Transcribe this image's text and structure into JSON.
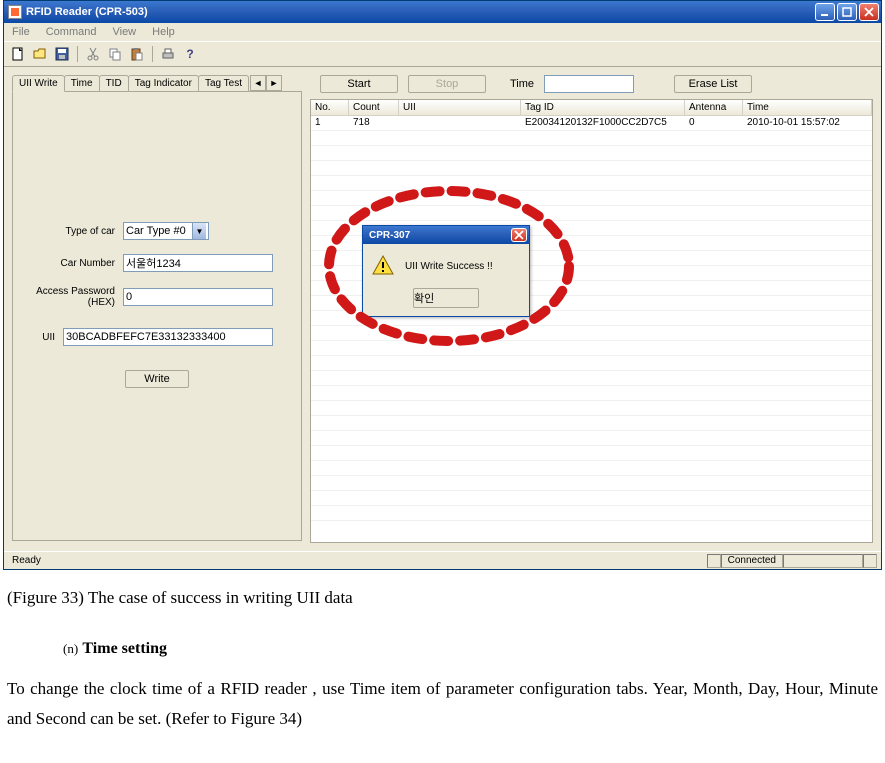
{
  "window": {
    "title": "RFID Reader (CPR-503)"
  },
  "menu": {
    "file": "File",
    "command": "Command",
    "view": "View",
    "help": "Help"
  },
  "tabs": {
    "uii_write": "UII Write",
    "time": "Time",
    "tid": "TID",
    "tag_indicator": "Tag Indicator",
    "tag_test": "Tag Test",
    "scroll_left": "◄",
    "scroll_right": "►"
  },
  "form": {
    "type_label": "Type of car",
    "type_value": "Car Type #0",
    "carnum_label": "Car Number",
    "carnum_value": "서울허1234",
    "apw_label_l1": "Access Password",
    "apw_label_l2": "(HEX)",
    "apw_value": "0",
    "uii_label": "UII",
    "uii_value": "30BCADBFEFC7E33132333400",
    "write_btn": "Write"
  },
  "controls": {
    "start": "Start",
    "stop": "Stop",
    "time_label": "Time",
    "time_value": "",
    "erase": "Erase List"
  },
  "table": {
    "headers": {
      "no": "No.",
      "count": "Count",
      "uii": "UII",
      "tagid": "Tag ID",
      "antenna": "Antenna",
      "time": "Time"
    },
    "rows": [
      {
        "no": "1",
        "count": "718",
        "uii": "",
        "tagid": "E20034120132F1000CC2D7C5",
        "antenna": "0",
        "time": "2010-10-01 15:57:02"
      }
    ]
  },
  "dialog": {
    "title": "CPR-307",
    "message": "UII Write Success !!",
    "ok": "확인"
  },
  "status": {
    "ready": "Ready",
    "connected": "Connected"
  },
  "doc": {
    "caption": "(Figure 33) The case of success in writing UII data",
    "sub_lbl": "(n)",
    "sub_title": "Time setting",
    "para": "To change the clock time of a RFID reader , use Time item of parameter configuration tabs. Year, Month, Day, Hour, Minute and Second can be set.  (Refer to Figure 34)"
  }
}
